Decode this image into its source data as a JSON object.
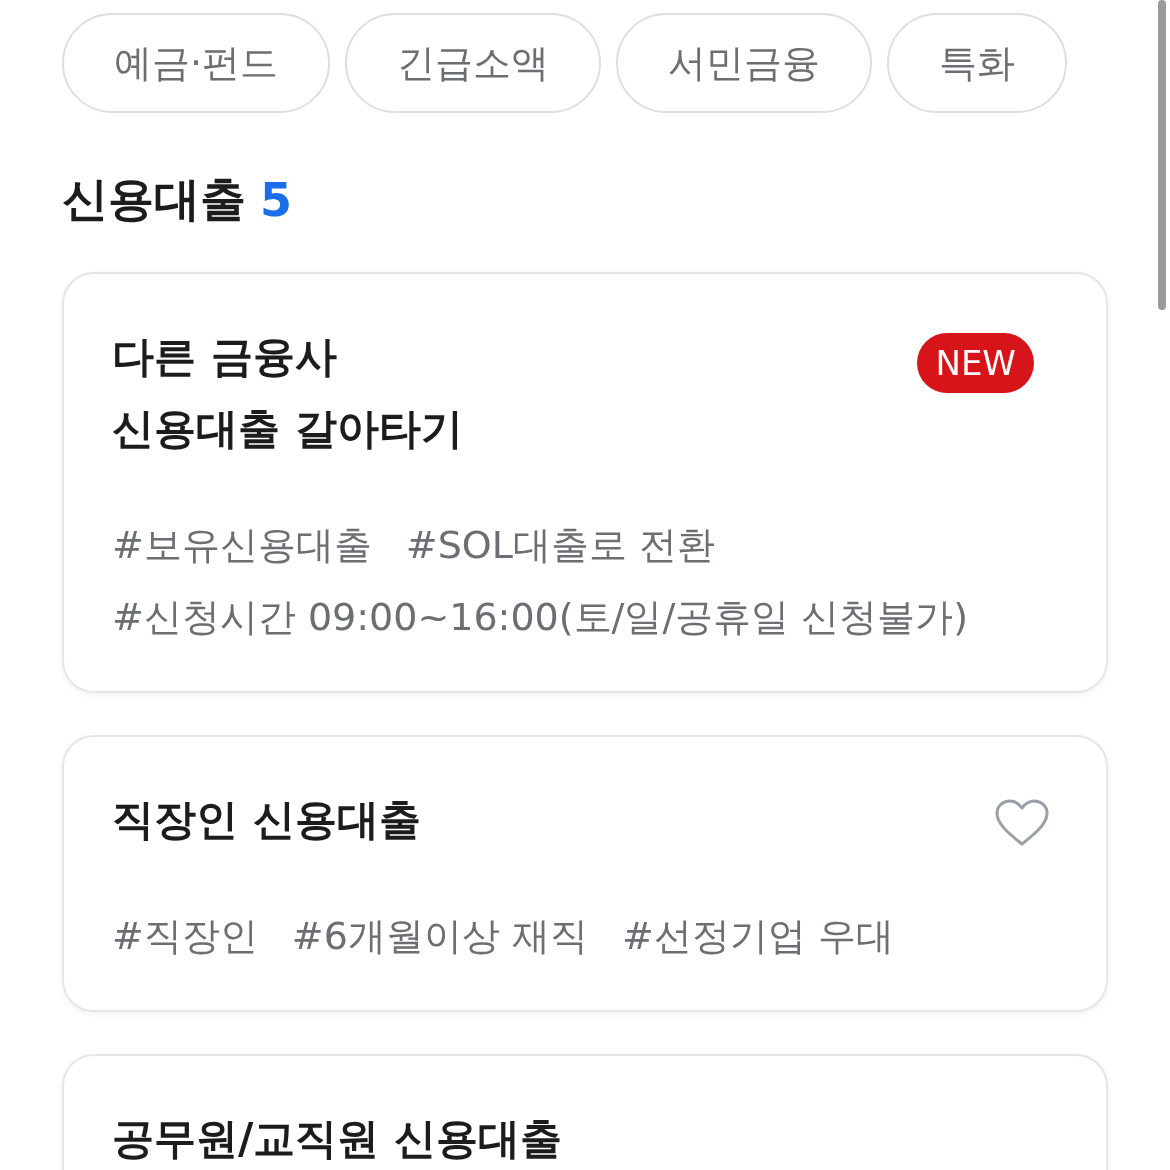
{
  "filter_chips": [
    {
      "label": "예금·펀드"
    },
    {
      "label": "긴급소액"
    },
    {
      "label": "서민금융"
    },
    {
      "label": "특화"
    }
  ],
  "section": {
    "title": "신용대출",
    "count": "5"
  },
  "cards": [
    {
      "title": "다른 금융사\n신용대출 갈아타기",
      "marker": {
        "kind": "badge",
        "text": "NEW"
      },
      "tags": [
        "#보유신용대출",
        "#SOL대출로 전환",
        "#신청시간 09:00~16:00(토/일/공휴일 신청불가)"
      ]
    },
    {
      "title": "직장인 신용대출",
      "marker": {
        "kind": "heart",
        "on": false
      },
      "tags": [
        "#직장인",
        "#6개월이상 재직",
        "#선정기업 우대"
      ]
    },
    {
      "title": "공무원/교직원 신용대출"
    }
  ]
}
